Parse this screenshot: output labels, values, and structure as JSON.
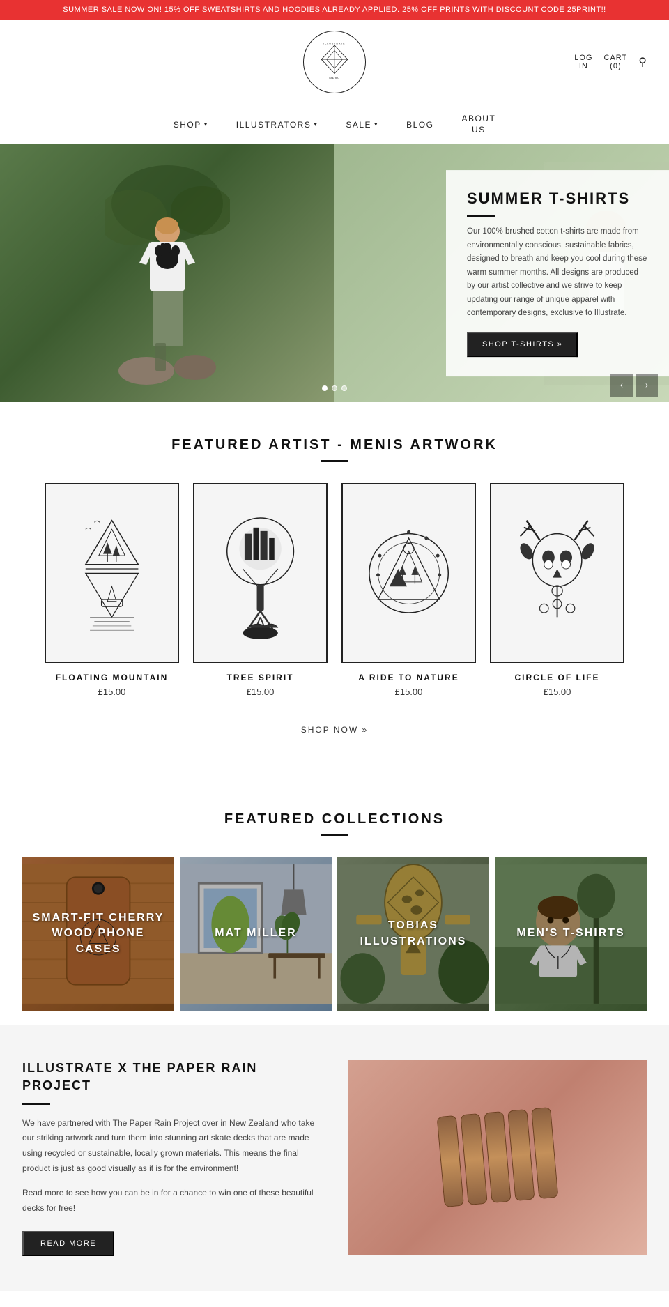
{
  "sale_banner": {
    "text": "SUMMER SALE NOW ON! 15% OFF SWEATSHIRTS AND HOODIES ALREADY APPLIED. 25% OFF PRINTS WITH DISCOUNT CODE 25PRINT!!"
  },
  "header": {
    "logo_top": "ILLUSTRATE",
    "logo_bottom": "MMXV",
    "login_label": "LOG\nIN",
    "cart_label": "CART\n(0)"
  },
  "nav": {
    "items": [
      {
        "label": "SHOP",
        "has_dropdown": true
      },
      {
        "label": "ILLUSTRATORS",
        "has_dropdown": true
      },
      {
        "label": "SALE",
        "has_dropdown": true
      },
      {
        "label": "BLOG",
        "has_dropdown": false
      },
      {
        "label": "ABOUT\nUS",
        "has_dropdown": false
      }
    ]
  },
  "hero": {
    "title": "SUMMER T-SHIRTS",
    "description": "Our 100% brushed cotton t-shirts are made from environmentally conscious, sustainable fabrics, designed to breath and keep you cool during these warm summer months. All designs are produced by our artist collective and we strive to keep updating our range of unique apparel with contemporary designs, exclusive to Illustrate.",
    "button_label": "SHOP T-SHIRTS »",
    "dots": [
      true,
      false,
      false
    ],
    "prev_arrow": "‹",
    "next_arrow": "›"
  },
  "featured_artist": {
    "section_title": "FEATURED ARTIST - MENIS ARTWORK",
    "products": [
      {
        "name": "FLOATING MOUNTAIN",
        "price": "£15.00"
      },
      {
        "name": "TREE SPIRIT",
        "price": "£15.00"
      },
      {
        "name": "A RIDE TO NATURE",
        "price": "£15.00"
      },
      {
        "name": "CIRCLE OF LIFE",
        "price": "£15.00"
      }
    ],
    "shop_now_label": "SHOP NOW »"
  },
  "featured_collections": {
    "section_title": "FEATURED COLLECTIONS",
    "collections": [
      {
        "label": "SMART-FIT CHERRY WOOD PHONE CASES",
        "bg": "cherry-wood"
      },
      {
        "label": "MAT MILLER",
        "bg": "mat-miller"
      },
      {
        "label": "TOBIAS ILLUSTRATIONS",
        "bg": "tobias"
      },
      {
        "label": "MEN'S T-SHIRTS",
        "bg": "mens-tshirts"
      }
    ]
  },
  "paper_rain": {
    "title": "ILLUSTRATE X THE PAPER RAIN PROJECT",
    "paragraph1": "We have partnered with The Paper Rain Project over in New Zealand who take our striking artwork and turn them into stunning art skate decks that are made using recycled or sustainable, locally grown materials. This means the final product is just as good visually as it is for the environment!",
    "paragraph2": "Read more to see how you can be in for a chance to win one of these beautiful decks for free!",
    "button_label": "READ MORE"
  }
}
